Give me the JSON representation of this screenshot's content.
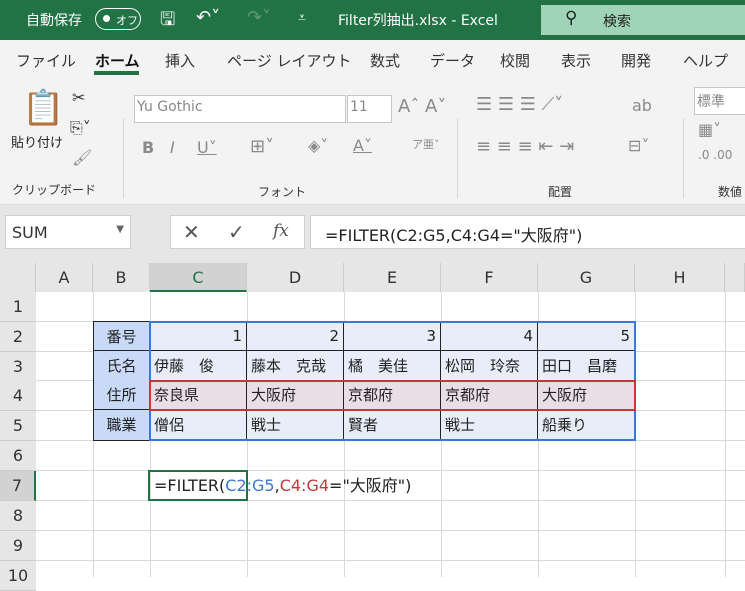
{
  "titlebar": {
    "autosave": "自動保存",
    "toggle": "オフ",
    "filename": "Filter列抽出.xlsx  -  Excel",
    "search": "検索"
  },
  "tabs": [
    "ファイル",
    "ホーム",
    "挿入",
    "ページ レイアウト",
    "数式",
    "データ",
    "校閲",
    "表示",
    "開発",
    "ヘルプ"
  ],
  "ribbon": {
    "paste": "貼り付け",
    "font_name": "Yu Gothic",
    "font_size": "11",
    "number_format": "標準",
    "groups": [
      "クリップボード",
      "フォント",
      "配置",
      "数値"
    ]
  },
  "formula_bar": {
    "name_box": "SUM",
    "formula": "=FILTER(C2:G5,C4:G4=\"大阪府\")"
  },
  "columns": [
    "A",
    "B",
    "C",
    "D",
    "E",
    "F",
    "G",
    "H"
  ],
  "rows": [
    "1",
    "2",
    "3",
    "4",
    "5",
    "6",
    "7",
    "8",
    "9",
    "10"
  ],
  "table": {
    "headers": [
      "番号",
      "氏名",
      "住所",
      "職業"
    ],
    "data": [
      [
        "1",
        "2",
        "3",
        "4",
        "5"
      ],
      [
        "伊藤　俊",
        "藤本　克哉",
        "橘　美佳",
        "松岡　玲奈",
        "田口　昌磨"
      ],
      [
        "奈良県",
        "大阪府",
        "京都府",
        "京都府",
        "大阪府"
      ],
      [
        "僧侶",
        "戦士",
        "賢者",
        "戦士",
        "船乗り"
      ]
    ]
  },
  "edit_cell": {
    "prefix": "=FILTER(",
    "ref1": "C2:G5",
    "comma": ",",
    "ref2": "C4:G4",
    "suffix": "=\"大阪府\")"
  },
  "colors": {
    "title_bar": "#217346",
    "ref1": "#3a78d6",
    "ref2": "#c8353b"
  }
}
